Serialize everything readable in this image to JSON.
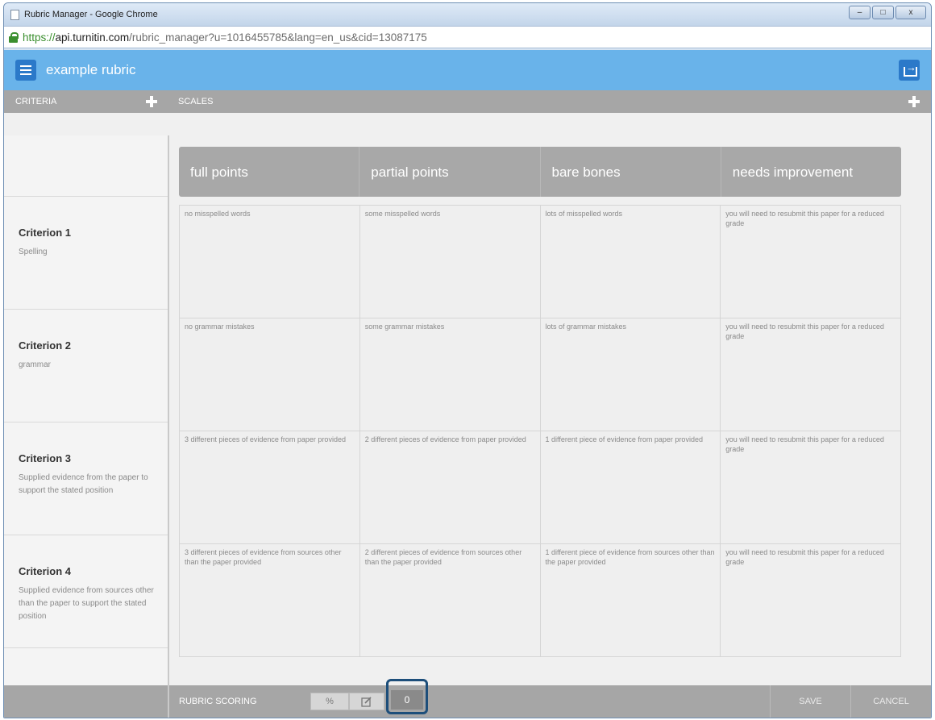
{
  "window": {
    "title": "Rubric Manager - Google Chrome",
    "controls": {
      "minimize": "–",
      "maximize": "□",
      "close": "x"
    }
  },
  "address_bar": {
    "scheme": "https://",
    "domain": "api.turnitin.com",
    "path": "/rubric_manager?u=1016455785&lang=en_us&cid=13087175"
  },
  "app": {
    "rubric_name": "example rubric"
  },
  "section_bar": {
    "criteria_label": "CRITERIA",
    "scales_label": "SCALES"
  },
  "scales": [
    "full points",
    "partial points",
    "bare bones",
    "needs improvement"
  ],
  "criteria": [
    {
      "title": "Criterion 1",
      "description": "Spelling",
      "cells": [
        "no misspelled words",
        "some misspelled words",
        "lots of misspelled words",
        "you will need to resubmit this paper for a reduced grade"
      ]
    },
    {
      "title": "Criterion 2",
      "description": "grammar",
      "cells": [
        "no grammar mistakes",
        "some grammar mistakes",
        "lots of grammar mistakes",
        "you will need to resubmit this paper for a reduced grade"
      ]
    },
    {
      "title": "Criterion 3",
      "description": "Supplied evidence from the paper to support the stated position",
      "cells": [
        "3 different pieces of evidence from paper provided",
        "2 different pieces of evidence from paper provided",
        "1 different piece of evidence from paper provided",
        "you will need to resubmit this paper for a reduced grade"
      ]
    },
    {
      "title": "Criterion 4",
      "description": "Supplied evidence from sources other than the paper to support the stated position",
      "cells": [
        "3 different pieces of evidence from sources other than the paper provided",
        "2 different pieces of evidence from sources other than the paper provided",
        "1 different piece of evidence from sources other than the paper provided",
        "you will need to resubmit this paper for a reduced grade"
      ]
    }
  ],
  "footer": {
    "scoring_label": "RUBRIC SCORING",
    "percent_label": "%",
    "score_value": "0",
    "save_label": "SAVE",
    "cancel_label": "CANCEL"
  }
}
